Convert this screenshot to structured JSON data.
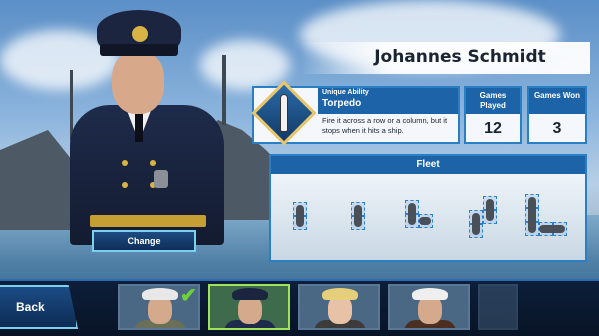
{
  "commander": {
    "name": "Johannes Schmidt",
    "change_label": "Change"
  },
  "ability": {
    "subtitle": "Unique Ability",
    "name": "Torpedo",
    "description": "Fire it across a row or a column, but it stops when it hits a ship.",
    "icon": "torpedo-icon"
  },
  "stats": {
    "games_played_label": "Games Played",
    "games_played": "12",
    "games_won_label": "Games Won",
    "games_won": "3"
  },
  "fleet": {
    "title": "Fleet"
  },
  "navigation": {
    "back_label": "Back"
  },
  "colors": {
    "panel_header": "#1d63a8",
    "panel_border": "#2a7ec4",
    "selected": "#9ee35a",
    "button_border": "#7bd0f0"
  }
}
